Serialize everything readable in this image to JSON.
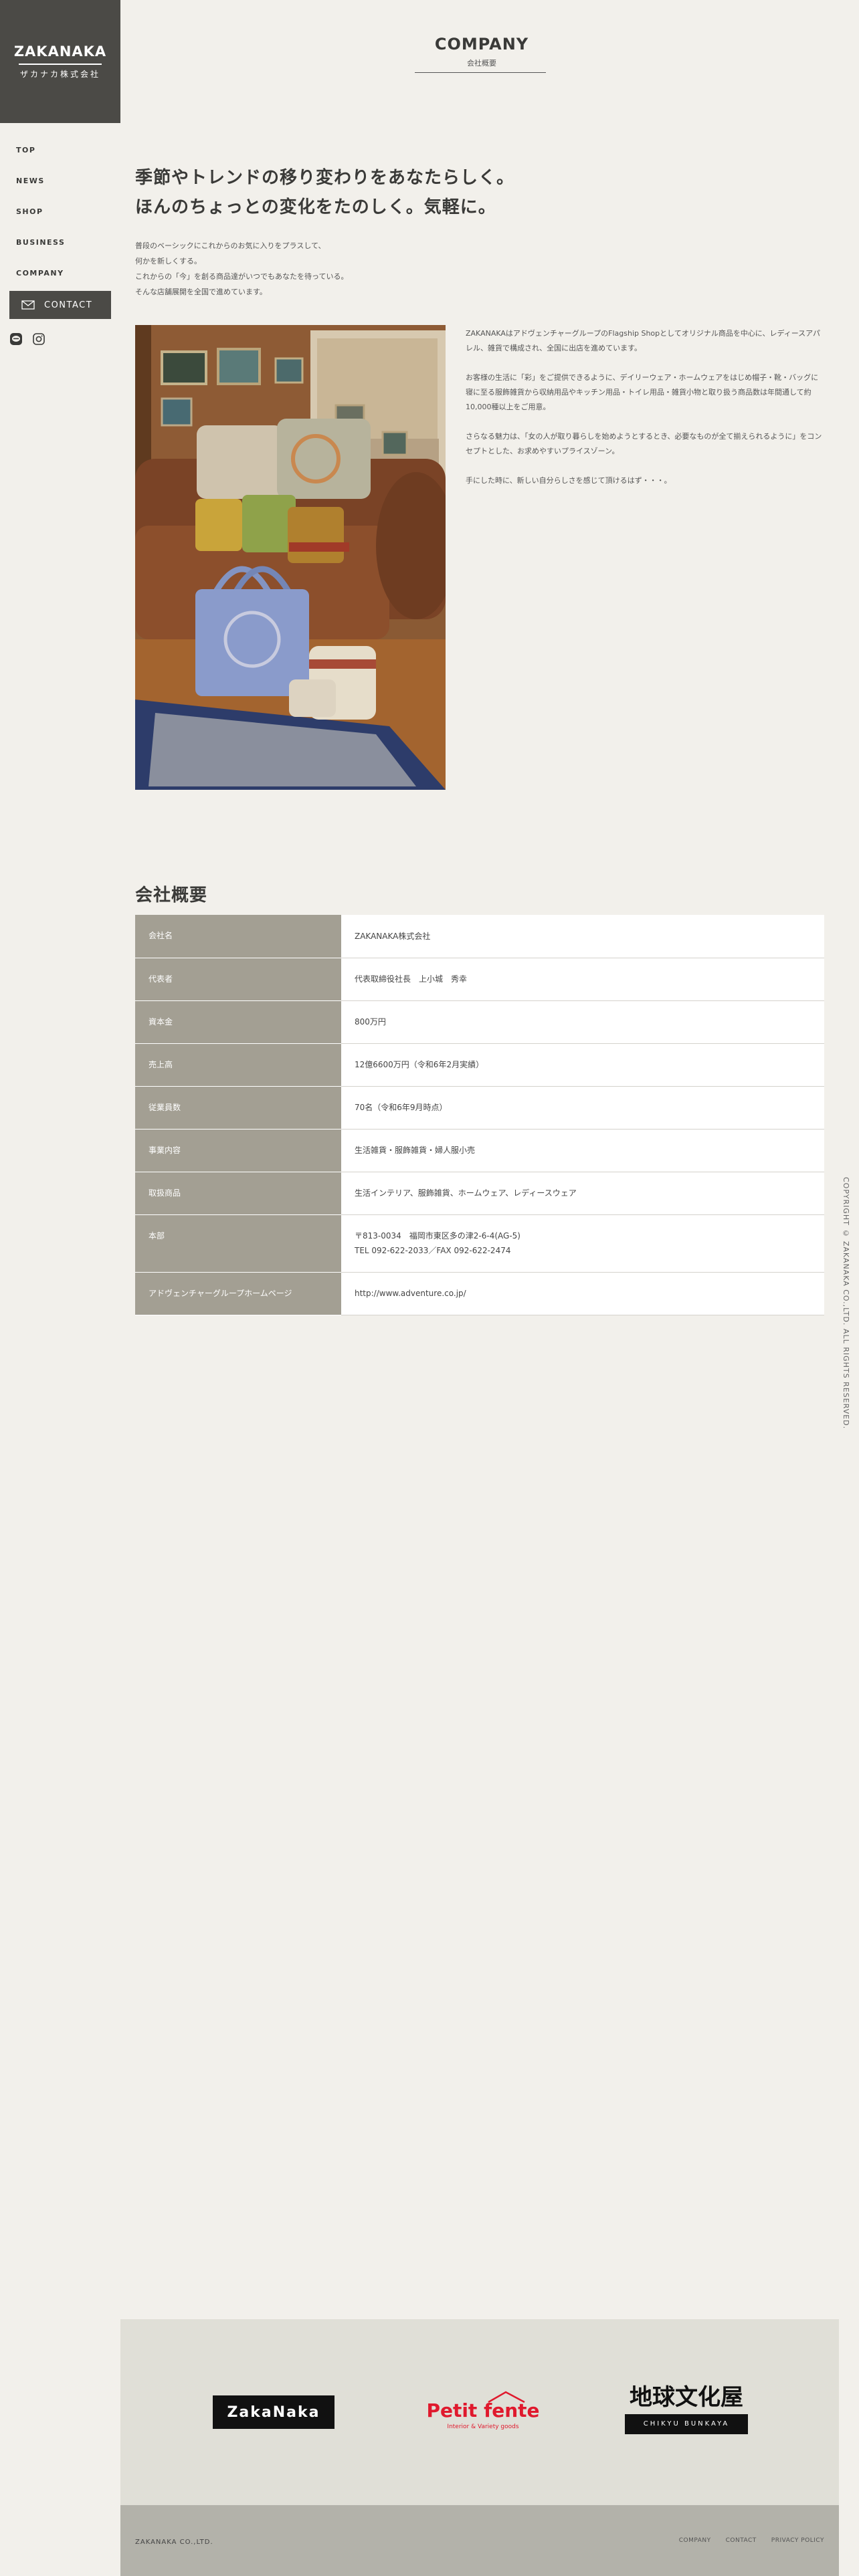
{
  "logo": {
    "name": "ZAKANAKA",
    "sub": "ザカナカ株式会社"
  },
  "nav": [
    "TOP",
    "NEWS",
    "SHOP",
    "BUSINESS",
    "COMPANY"
  ],
  "contact_label": "CONTACT",
  "social_icons": [
    "line-icon",
    "instagram-icon"
  ],
  "page": {
    "title": "COMPANY",
    "subtitle": "会社概要"
  },
  "heading": {
    "line1": "季節やトレンドの移り変わりをあなたらしく。",
    "line2": "ほんのちょっとの変化をたのしく。気軽に。"
  },
  "intro": [
    "普段のベーシックにこれからのお気に入りをプラスして、",
    "何かを新しくする。",
    "これからの「今」を創る商品達がいつでもあなたを待っている。",
    "そんな店舗展開を全国で進めています。"
  ],
  "description": [
    "ZAKANAKAはアドヴェンチャーグループのFlagship Shopとしてオリジナル商品を中心に、レディースアパレル、雑貨で構成され、全国に出店を進めています。",
    "お客様の生活に「彩」をご提供できるように、デイリーウェア・ホームウェアをはじめ帽子・靴・バッグに寝に至る服飾雑貨から収納用品やキッチン用品・トイレ用品・雑貨小物と取り扱う商品数は年間通して約10,000種以上をご用意。",
    "さらなる魅力は、「女の人が取り暮らしを始めようとするとき、必要なものが全て揃えられるように」をコンセプトとした、お求めやすいプライスゾーン。",
    "手にした時に、新しい自分らしさを感じて頂けるはず・・・。"
  ],
  "table": {
    "heading": "会社概要",
    "rows": [
      {
        "label": "会社名",
        "value": "ZAKANAKA株式会社"
      },
      {
        "label": "代表者",
        "value": "代表取締役社長　上小城　秀幸"
      },
      {
        "label": "資本金",
        "value": "800万円"
      },
      {
        "label": "売上高",
        "value": "12億6600万円（令和6年2月実績）"
      },
      {
        "label": "従業員数",
        "value": "70名（令和6年9月時点）"
      },
      {
        "label": "事業内容",
        "value": "生活雑貨・服飾雑貨・婦人服小売"
      },
      {
        "label": "取扱商品",
        "value": "生活インテリア、服飾雑貨、ホームウェア、レディースウェア"
      },
      {
        "label": "本部",
        "value": "〒813-0034　福岡市東区多の津2-6-4(AG-5)",
        "value2": "TEL 092-622-2033／FAX 092-622-2474"
      },
      {
        "label": "アドヴェンチャーグループホームページ",
        "value": "http://www.adventure.co.jp/"
      }
    ]
  },
  "copyright": "COPYRIGHT © ZAKANAKA CO.,LTD. ALL RIGHTS RESERVED.",
  "brands": {
    "zakanaka": "ZakaNaka",
    "petit_main": "Petit fente",
    "petit_sub": "Interior & Variety goods",
    "chikyu_main": "地球文化屋",
    "chikyu_sub": "CHIKYU BUNKAYA"
  },
  "footer": {
    "company": "ZAKANAKA CO.,LTD.",
    "links": [
      "COMPANY",
      "CONTACT",
      "PRIVACY POLICY"
    ]
  },
  "colors": {
    "dark": "#4b4a46",
    "table_label": "#a39f93",
    "brand_red": "#e0192d"
  }
}
